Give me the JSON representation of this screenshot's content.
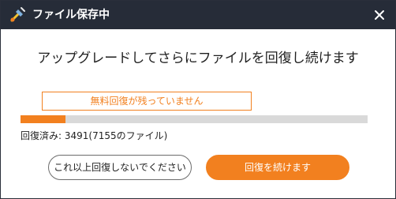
{
  "window": {
    "title": "ファイル保存中",
    "icons": {
      "app": "app-logo-icon",
      "close": "close-icon"
    }
  },
  "main": {
    "headline": "アップグレードしてさらにファイルを回復し続けます",
    "notice": "無料回復が残っていません",
    "progress": {
      "fraction": 0.13
    },
    "status": "回復済み: 3491(7155のファイル)"
  },
  "buttons": {
    "stop_label": "これ以上回復しないでください",
    "continue_label": "回復を続けます"
  },
  "colors": {
    "accent": "#f2801f",
    "titlebar": "#262c38",
    "track": "#d9d9d9"
  }
}
